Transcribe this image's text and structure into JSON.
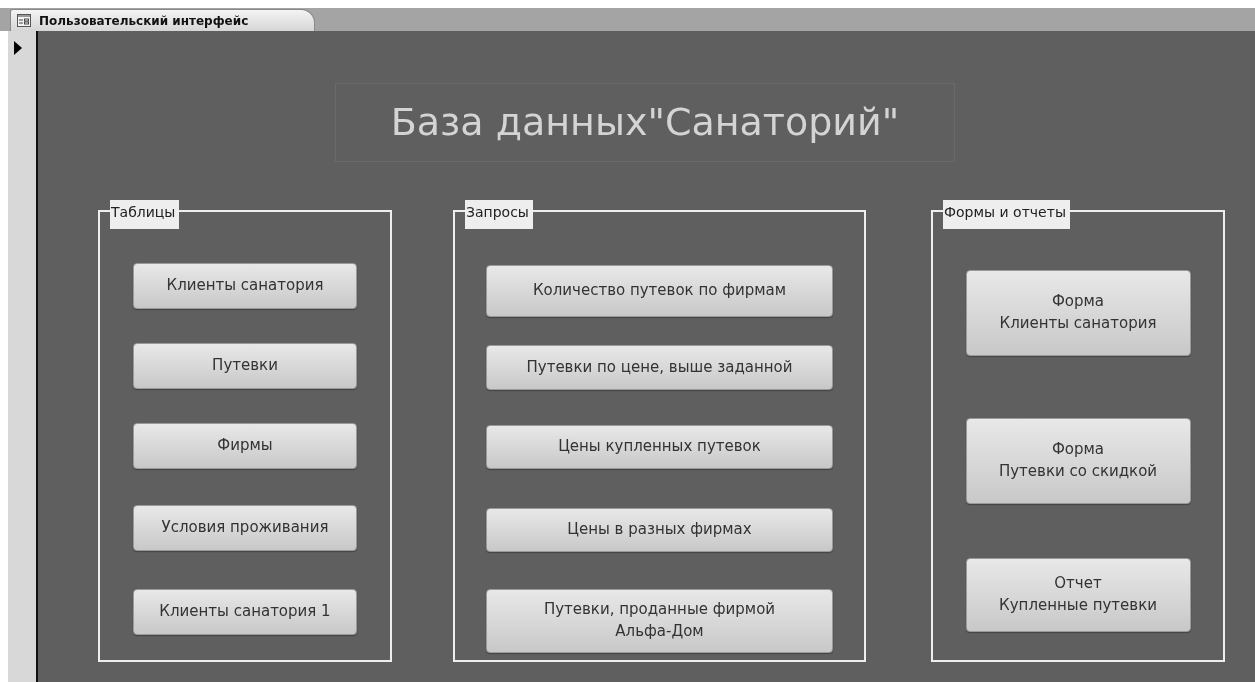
{
  "tab": {
    "label": "Пользовательский интерфейс"
  },
  "title": "База данных\"Санаторий\"",
  "groups": [
    {
      "label": "Таблицы",
      "buttons": [
        "Клиенты санатория",
        "Путевки",
        "Фирмы",
        "Условия проживания",
        "Клиенты санатория 1"
      ]
    },
    {
      "label": "Запросы",
      "buttons": [
        "Количество путевок по фирмам",
        "Путевки по цене, выше заданной",
        "Цены купленных путевок",
        "Цены в разных фирмах",
        "Путевки, проданные фирмой\nАльфа-Дом"
      ]
    },
    {
      "label": "Формы и отчеты",
      "buttons": [
        "Форма\nКлиенты санатория",
        "Форма\nПутевки со скидкой",
        "Отчет\nКупленные путевки"
      ]
    }
  ]
}
